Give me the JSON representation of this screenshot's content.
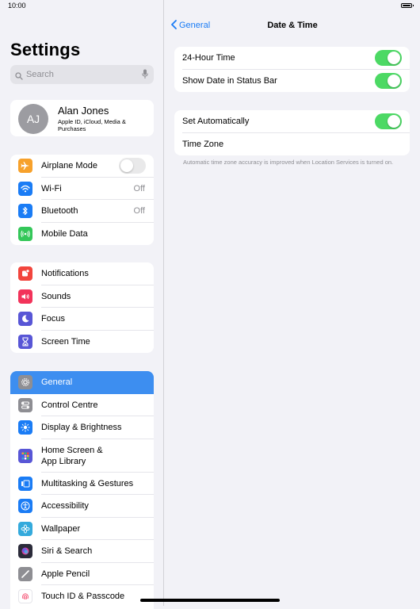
{
  "status_bar": {
    "time": "10:00"
  },
  "sidebar": {
    "title": "Settings",
    "search": {
      "placeholder": "Search"
    },
    "profile": {
      "initials": "AJ",
      "name": "Alan Jones",
      "subtitle": "Apple ID, iCloud, Media & Purchases"
    },
    "group1": [
      {
        "label": "Airplane Mode",
        "icon": "airplane-icon",
        "color": "#f7a12b",
        "toggle": false
      },
      {
        "label": "Wi-Fi",
        "icon": "wifi-icon",
        "color": "#1a7cf5",
        "value": "Off"
      },
      {
        "label": "Bluetooth",
        "icon": "bluetooth-icon",
        "color": "#1a7cf5",
        "value": "Off"
      },
      {
        "label": "Mobile Data",
        "icon": "antenna-icon",
        "color": "#34c759"
      }
    ],
    "group2": [
      {
        "label": "Notifications",
        "icon": "bell-icon",
        "color": "#f2453d"
      },
      {
        "label": "Sounds",
        "icon": "speaker-icon",
        "color": "#f2335a"
      },
      {
        "label": "Focus",
        "icon": "moon-icon",
        "color": "#5856d6"
      },
      {
        "label": "Screen Time",
        "icon": "hourglass-icon",
        "color": "#5856d6"
      }
    ],
    "group3": [
      {
        "label": "General",
        "icon": "gear-icon",
        "color": "#8e8e93",
        "selected": true
      },
      {
        "label": "Control Centre",
        "icon": "switches-icon",
        "color": "#8e8e93"
      },
      {
        "label": "Display & Brightness",
        "icon": "sun-icon",
        "color": "#1a7cf5"
      },
      {
        "label": "Home Screen &",
        "label2": "App Library",
        "icon": "grid-icon",
        "color": "#5856d6"
      },
      {
        "label": "Multitasking & Gestures",
        "icon": "multitask-icon",
        "color": "#1a7cf5"
      },
      {
        "label": "Accessibility",
        "icon": "accessibility-icon",
        "color": "#1a7cf5"
      },
      {
        "label": "Wallpaper",
        "icon": "flower-icon",
        "color": "#34aadc"
      },
      {
        "label": "Siri & Search",
        "icon": "siri-icon",
        "color": "#2b2b3a"
      },
      {
        "label": "Apple Pencil",
        "icon": "pencil-icon",
        "color": "#8e8e93"
      },
      {
        "label": "Touch ID & Passcode",
        "icon": "fingerprint-icon",
        "color": "#ffffff"
      }
    ]
  },
  "detail": {
    "back_label": "General",
    "title": "Date & Time",
    "group1": [
      {
        "label": "24-Hour Time",
        "toggle": true
      },
      {
        "label": "Show Date in Status Bar",
        "toggle": true
      }
    ],
    "group2": [
      {
        "label": "Set Automatically",
        "toggle": true
      },
      {
        "label": "Time Zone"
      }
    ],
    "footnote": "Automatic time zone accuracy is improved when Location Services is turned on."
  },
  "colors": {
    "accent": "#1a7cf5",
    "toggle_on": "#4cd964",
    "selected_row": "#3d8ef0"
  }
}
